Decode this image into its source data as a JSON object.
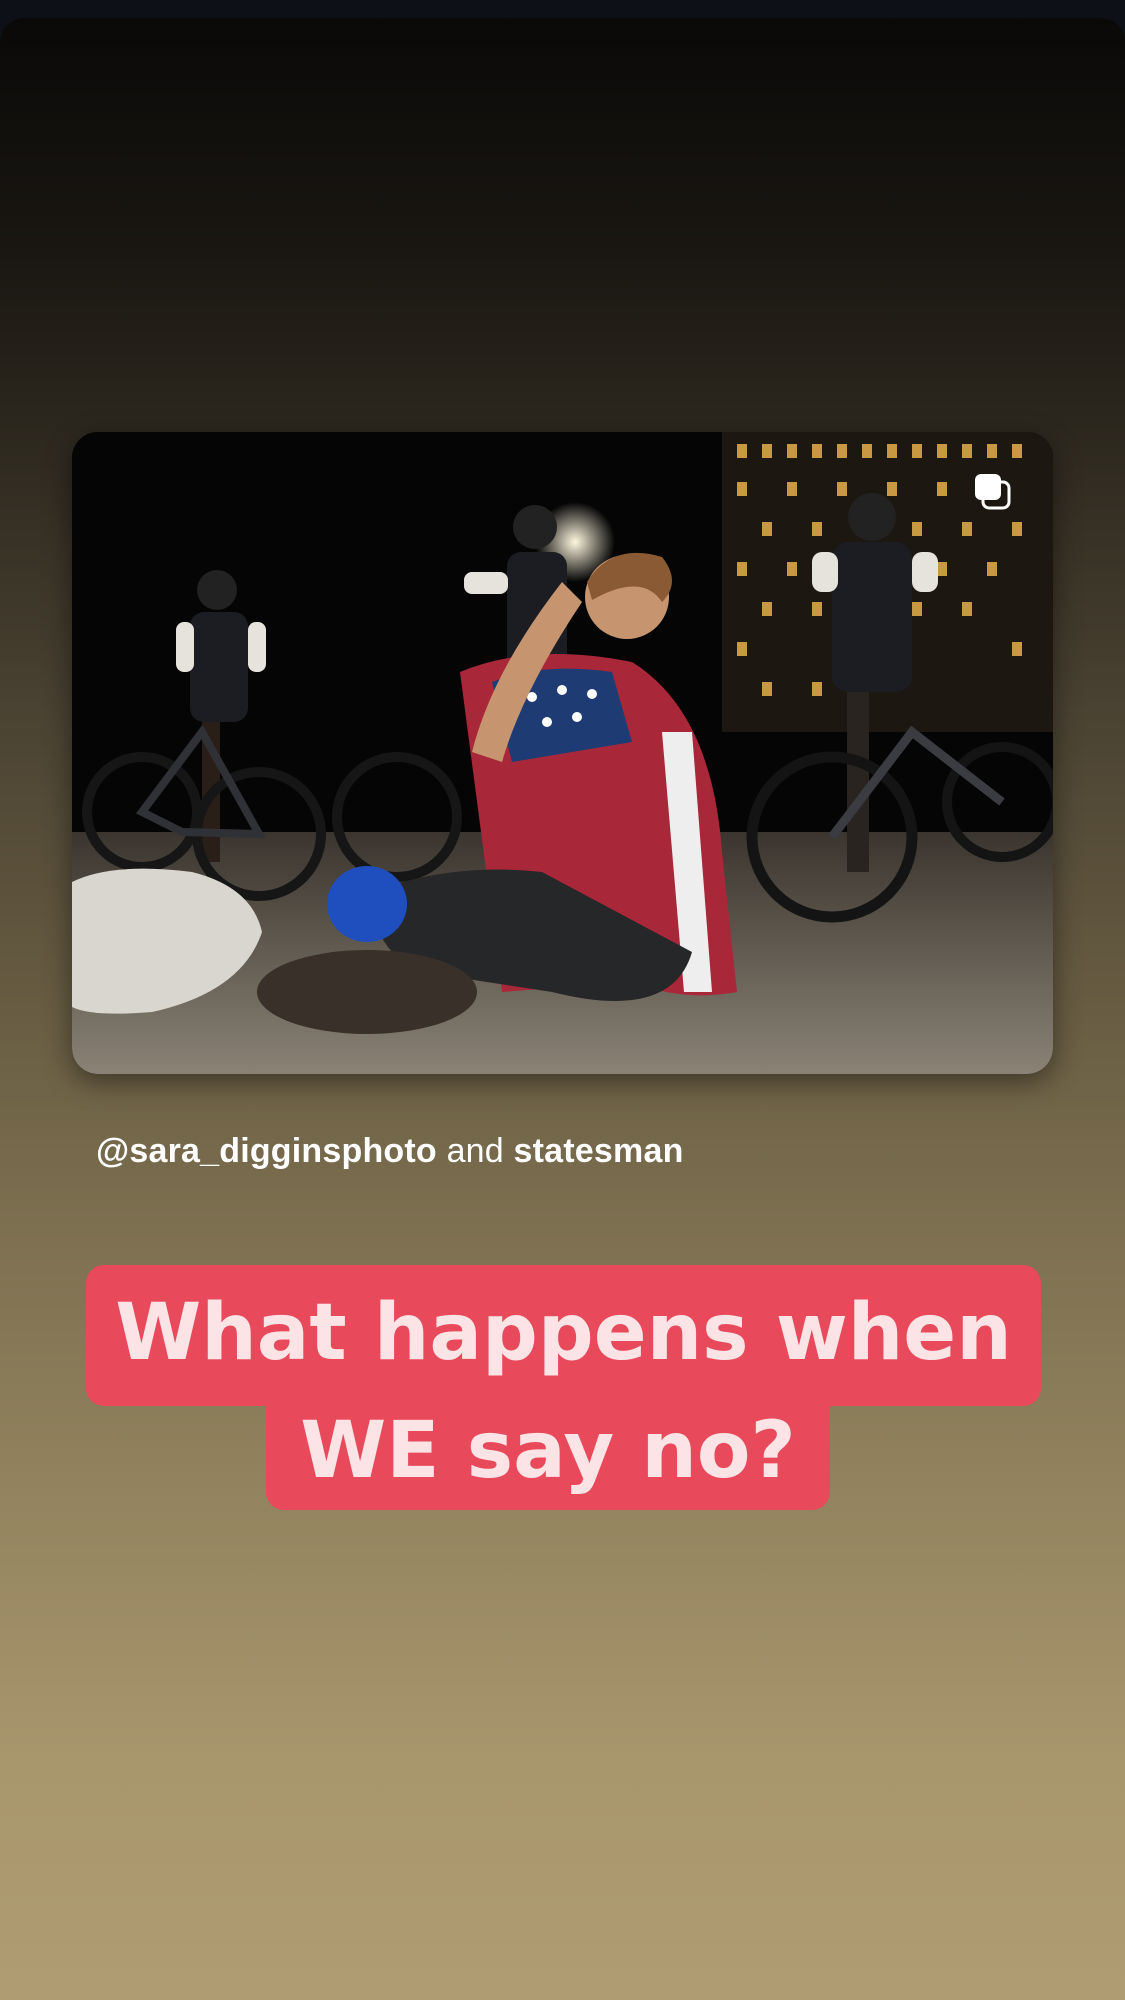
{
  "story": {
    "background_top": "#0a0908",
    "background_bottom": "#b09c72"
  },
  "post": {
    "photo_description_icon": "photo-placeholder",
    "multiple_photos_icon": "carousel-icon"
  },
  "credit": {
    "account_1": "@sara_digginsphoto",
    "conjunction": "and",
    "account_2": "statesman"
  },
  "sticker": {
    "line_1": "What happens when",
    "line_2": "WE say no?",
    "background_color": "#e84a5c",
    "text_color": "#fbe3e6"
  }
}
